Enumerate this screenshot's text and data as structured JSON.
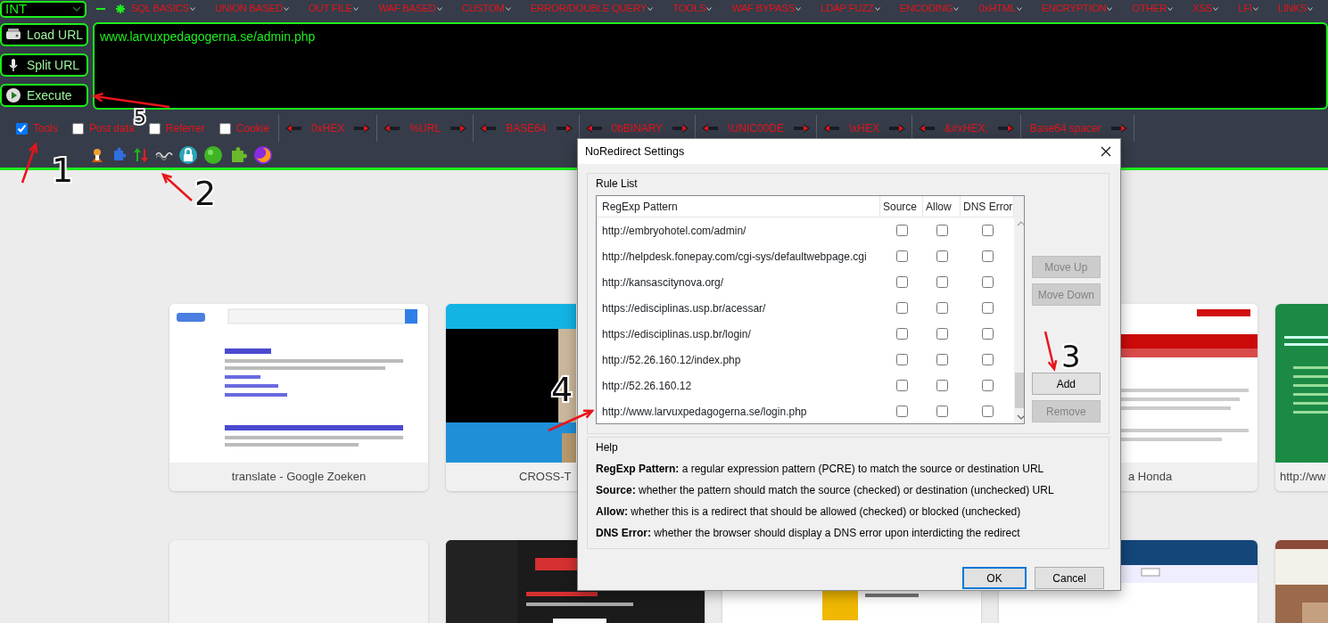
{
  "toolbar": {
    "mode_select": {
      "value": "INT"
    },
    "menus": [
      "SQL BASICS",
      "UNION BASED",
      "OUT FILE",
      "WAF BASED",
      "CUSTOM",
      "ERROR/DOUBLE QUERY",
      "TOOLS",
      "WAF BYPASS",
      "LDAP FUZZ",
      "ENCODING",
      "0xHTML",
      "ENCRYPTION",
      "OTHER",
      "XSS",
      "LFI",
      "LINKS"
    ],
    "buttons": [
      "Load URL",
      "Split URL",
      "Execute"
    ],
    "url": "www.larvuxpedagogerna.se/admin.php",
    "options": [
      {
        "label": "Tools",
        "checked": true
      },
      {
        "label": "Post data",
        "checked": false
      },
      {
        "label": "Referrer",
        "checked": false
      },
      {
        "label": "Cookie",
        "checked": false
      }
    ],
    "encoders": [
      {
        "label": "0xHEX",
        "left_arrow": true,
        "right_arrow": true
      },
      {
        "label": "%URL",
        "left_arrow": true,
        "right_arrow": true
      },
      {
        "label": "BASE64",
        "left_arrow": true,
        "right_arrow": true
      },
      {
        "label": "0bBINARY",
        "left_arrow": true,
        "right_arrow": true
      },
      {
        "label": "\\UNIC00DE",
        "left_arrow": true,
        "right_arrow": true
      },
      {
        "label": "\\xHEX",
        "left_arrow": true,
        "right_arrow": true
      },
      {
        "label": "&#xHEX;",
        "left_arrow": true,
        "right_arrow": true
      },
      {
        "label": "Base64 spacer",
        "left_arrow": false,
        "right_arrow": true
      }
    ]
  },
  "thumbnail_rows": [
    [
      {
        "kind": "picture",
        "caption": "translate - Google Zoeken"
      },
      {
        "kind": "picture",
        "caption": "CROSS-T"
      },
      {
        "kind": "picture",
        "caption": "a Honda"
      },
      {
        "kind": "picture",
        "caption": "http://ww"
      }
    ],
    [
      {
        "kind": "empty"
      },
      {
        "kind": "picture"
      },
      {
        "kind": "picture"
      },
      {
        "kind": "picture"
      },
      {
        "kind": "picture"
      }
    ]
  ],
  "dialog": {
    "title": "NoRedirect Settings",
    "rule_list": {
      "title": "Rule List",
      "columns": [
        "RegExp Pattern",
        "Source",
        "Allow",
        "DNS Error"
      ],
      "rows": [
        {
          "pattern": "http://embryohotel.com/admin/",
          "source": false,
          "allow": false,
          "dns_error": false
        },
        {
          "pattern": "http://helpdesk.fonepay.com/cgi-sys/defaultwebpage.cgi",
          "source": false,
          "allow": false,
          "dns_error": false
        },
        {
          "pattern": "http://kansascitynova.org/",
          "source": false,
          "allow": false,
          "dns_error": false
        },
        {
          "pattern": "https://edisciplinas.usp.br/acessar/",
          "source": false,
          "allow": false,
          "dns_error": false
        },
        {
          "pattern": "https://edisciplinas.usp.br/login/",
          "source": false,
          "allow": false,
          "dns_error": false
        },
        {
          "pattern": "http://52.26.160.12/index.php",
          "source": false,
          "allow": false,
          "dns_error": false
        },
        {
          "pattern": "http://52.26.160.12",
          "source": false,
          "allow": false,
          "dns_error": false
        },
        {
          "pattern": "http://www.larvuxpedagogerna.se/login.php",
          "source": false,
          "allow": false,
          "dns_error": false
        }
      ]
    },
    "side_buttons": [
      {
        "label": "Move Up",
        "disabled": true
      },
      {
        "label": "Move Down",
        "disabled": true
      },
      {
        "label": "Add",
        "disabled": false
      },
      {
        "label": "Remove",
        "disabled": true
      }
    ],
    "help": {
      "title": "Help",
      "lines": [
        "**RegExp Pattern:** a regular expression pattern (PCRE) to match the source or destination URL",
        "**Source:** whether the pattern should match the source (checked) or destination (unchecked) URL",
        "**Allow:** whether this is a redirect that should be allowed (checked) or blocked (unchecked)",
        "**DNS Error:** whether the browser should display a DNS error upon interdicting the redirect"
      ]
    },
    "buttons": [
      {
        "label": "OK",
        "default": true
      },
      {
        "label": "Cancel",
        "default": false
      }
    ]
  },
  "annotations": [
    "5",
    "1",
    "2",
    "3",
    "4"
  ]
}
